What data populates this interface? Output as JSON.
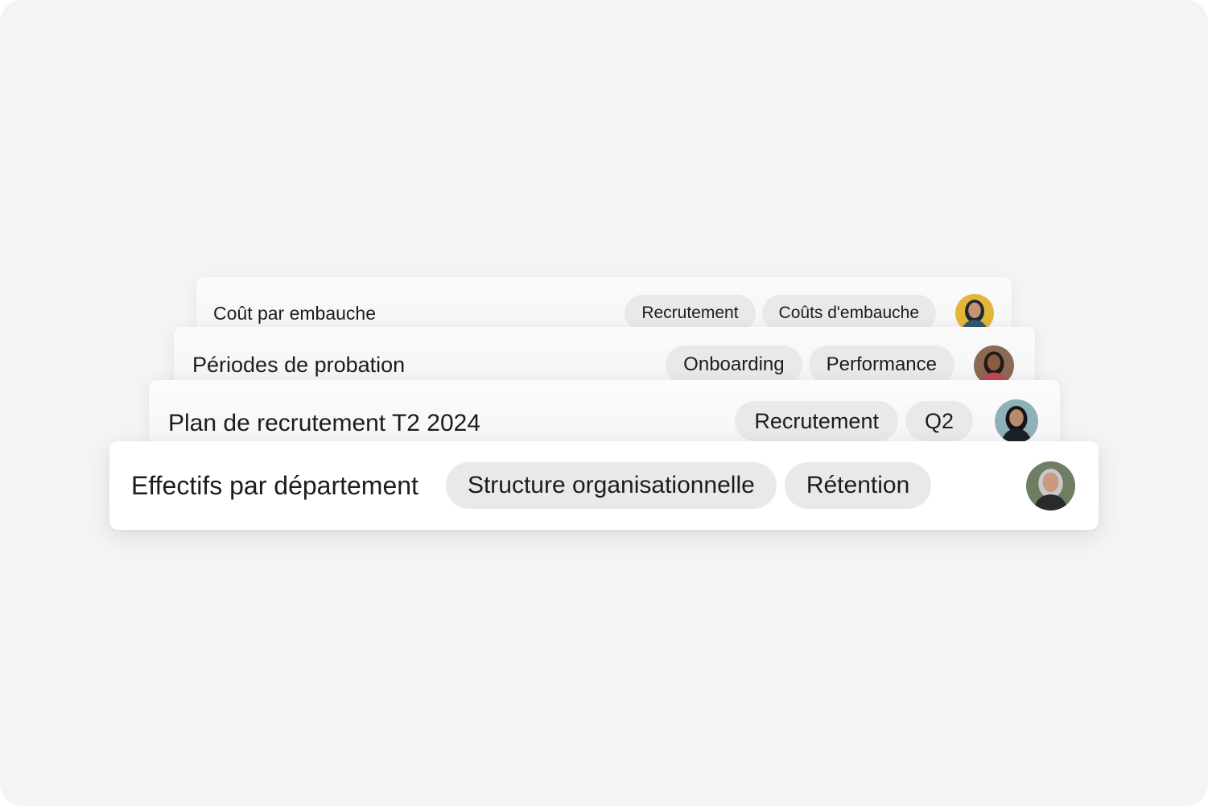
{
  "cards": [
    {
      "title": "Coût par embauche",
      "tags": [
        "Recrutement",
        "Coûts d'embauche"
      ],
      "avatar": {
        "name": "woman-dark-hair-yellow-background",
        "bg": "#e3b63a",
        "hair": "#1e2a30",
        "skin": "#c89277",
        "shirt": "#2e5a72"
      }
    },
    {
      "title": "Périodes de probation",
      "tags": [
        "Onboarding",
        "Performance"
      ],
      "avatar": {
        "name": "man-apron-workshop",
        "bg": "#8a6a55",
        "hair": "#231a16",
        "skin": "#8b5a43",
        "shirt": "#c0485a"
      }
    },
    {
      "title": "Plan de recrutement T2 2024",
      "tags": [
        "Recrutement",
        "Q2"
      ],
      "avatar": {
        "name": "woman-long-dark-hair-seaside",
        "bg": "#8fb0b6",
        "hair": "#141414",
        "skin": "#b98a6d",
        "shirt": "#1b2226"
      }
    },
    {
      "title": "Effectifs par département",
      "tags": [
        "Structure organisationnelle",
        "Rétention"
      ],
      "avatar": {
        "name": "woman-grey-hair-outdoors",
        "bg": "#6f7d63",
        "hair": "#c9c9c9",
        "skin": "#c89a80",
        "shirt": "#2a2a2a"
      }
    }
  ]
}
